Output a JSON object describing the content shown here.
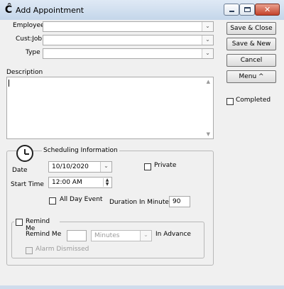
{
  "window": {
    "title": "Add Appointment",
    "app_icon_glyph": "Ĉ",
    "controls": [
      "minimize",
      "maximize",
      "close"
    ]
  },
  "form": {
    "employee_label": "Employee",
    "custjob_label": "Cust:Job",
    "type_label": "Type",
    "description_label": "Description",
    "employee_value": "",
    "custjob_value": "",
    "type_value": "",
    "description_value": ""
  },
  "buttons": {
    "save_close": "Save & Close",
    "save_new": "Save & New",
    "cancel": "Cancel",
    "menu": "Menu ^"
  },
  "completed": {
    "label": "Completed",
    "checked": false
  },
  "scheduling": {
    "legend": "Scheduling Information",
    "date_label": "Date",
    "date_value": "10/10/2020",
    "start_time_label": "Start Time",
    "start_time_value": "12:00 AM",
    "private_label": "Private",
    "private_checked": false,
    "all_day_label": "All Day Event",
    "all_day_checked": false,
    "duration_label": "Duration In Minutes",
    "duration_value": "90"
  },
  "remind": {
    "legend": "Remind Me",
    "remind_me_label": "Remind Me",
    "remind_value": "",
    "units_value": "Minutes",
    "in_advance_label": "In Advance",
    "alarm_dismissed_label": "Alarm Dismissed",
    "checked": false
  },
  "icons": {
    "clock": "clock-icon",
    "dropdown": "chevron-down-icon",
    "spinner": "spinner-arrows-icon",
    "calendar": "calendar-dropdown-icon"
  }
}
